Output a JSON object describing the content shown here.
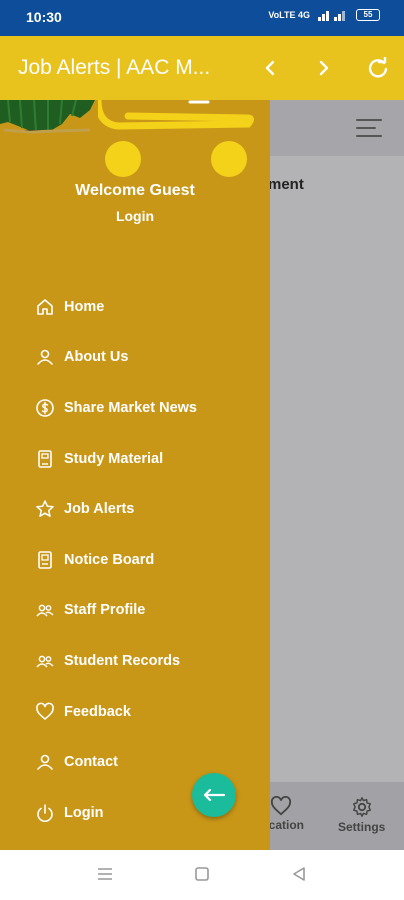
{
  "status_bar": {
    "time": "10:30",
    "network": "VoLTE 4G",
    "battery": "55"
  },
  "app_bar": {
    "title": "Job Alerts | AAC M...",
    "back_icon": "chevron-left-icon",
    "forward_icon": "chevron-right-icon",
    "refresh_icon": "refresh-icon",
    "background_color": "#e8c21d"
  },
  "page_behind": {
    "partial_text": "ment",
    "bottom_nav": [
      {
        "label": "ification",
        "icon": "heart-icon"
      },
      {
        "label": "Settings",
        "icon": "gear-icon"
      }
    ]
  },
  "drawer": {
    "background_color": "#c99717",
    "welcome": "Welcome Guest",
    "login_link": "Login",
    "items": [
      {
        "label": "Home",
        "icon": "home-icon"
      },
      {
        "label": "About Us",
        "icon": "user-icon"
      },
      {
        "label": "Share Market News",
        "icon": "dollar-icon"
      },
      {
        "label": "Study Material",
        "icon": "book-icon"
      },
      {
        "label": "Job Alerts",
        "icon": "star-icon"
      },
      {
        "label": "Notice Board",
        "icon": "notice-icon"
      },
      {
        "label": "Staff Profile",
        "icon": "users-icon"
      },
      {
        "label": "Student Records",
        "icon": "users-icon"
      },
      {
        "label": "Feedback",
        "icon": "heart-icon"
      },
      {
        "label": "Contact",
        "icon": "user-icon"
      },
      {
        "label": "Login",
        "icon": "power-icon"
      }
    ],
    "fab_icon": "arrow-left-icon",
    "fab_color": "#1abc9c"
  },
  "system_nav": [
    "menu-icon",
    "home-square-icon",
    "back-triangle-icon"
  ]
}
